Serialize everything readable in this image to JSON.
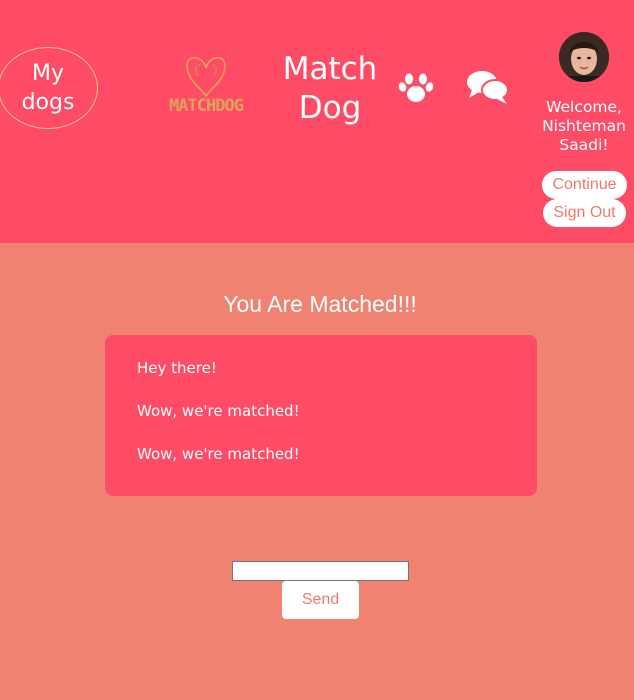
{
  "header": {
    "my_dogs_label": "My dogs",
    "logo_text": "MATCHDOG",
    "brand_title": "Match Dog",
    "paw_icon": "paw-icon",
    "chat_icon": "comments-icon",
    "welcome_text": "Welcome, Nishteman Saadi!",
    "continue_label": "Continue",
    "signout_label": "Sign Out"
  },
  "main": {
    "title": "You Are Matched!!!",
    "messages": [
      "Hey there!",
      "Wow, we're matched!",
      "Wow, we're matched!"
    ],
    "input_value": "",
    "send_label": "Send"
  },
  "colors": {
    "header_bg": "#fe4b66",
    "page_bg": "#f08272",
    "logo_gold": "#e0a25a"
  }
}
